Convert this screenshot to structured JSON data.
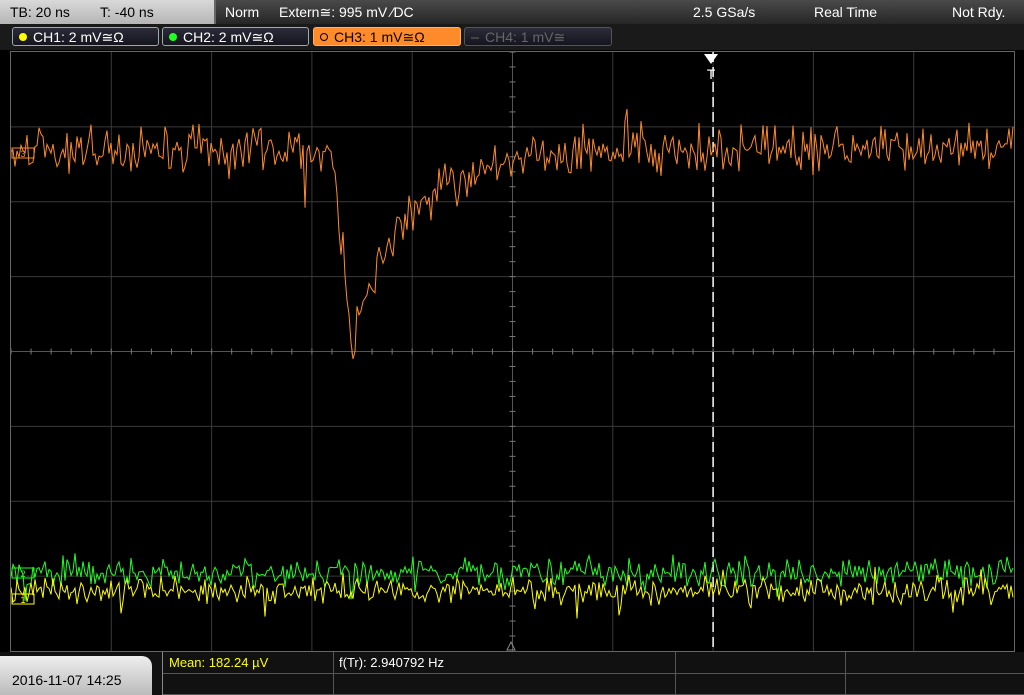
{
  "status_bar": {
    "timebase": "TB: 20 ns",
    "trigger_time": "T: -40 ns",
    "mode": "Norm",
    "trigger_source": "Extern≅: 995 mV ∕DC",
    "sample_rate": "2.5 GSa/s",
    "acq_mode": "Real Time",
    "state": "Not Rdy."
  },
  "channels": [
    {
      "label": "CH1: 2 mV≅Ω",
      "color": "#ffff00",
      "state": "on"
    },
    {
      "label": "CH2: 2 mV≅Ω",
      "color": "#22ff22",
      "state": "on"
    },
    {
      "label": "CH3: 1 mV≅Ω",
      "color": "#ff8a2a",
      "state": "active"
    },
    {
      "label": "CH4: 1 mV≅",
      "color": "#666666",
      "state": "off"
    }
  ],
  "markers": {
    "trigger": "T",
    "ch3": "3",
    "ch2": "2",
    "ch1": "1"
  },
  "date_time": "2016-11-07 14:25",
  "measurements": {
    "mean": "Mean: 182.24 µV",
    "freq": "f(Tr): 2.940792 Hz"
  },
  "chart_data": {
    "type": "line",
    "grid": true,
    "divisions": {
      "x": 10,
      "y": 8
    },
    "trigger_position_div": 7,
    "series": [
      {
        "name": "CH3",
        "color": "#ff8a2a",
        "baseline_div": 1.3,
        "pulse": {
          "start_div": 3.2,
          "min_div": 3.95,
          "min_time_div": 3.4,
          "recovery_div": 2.0
        }
      },
      {
        "name": "CH2",
        "color": "#22ff22",
        "baseline_div": 6.95
      },
      {
        "name": "CH1",
        "color": "#ffff00",
        "baseline_div": 7.2
      }
    ]
  }
}
